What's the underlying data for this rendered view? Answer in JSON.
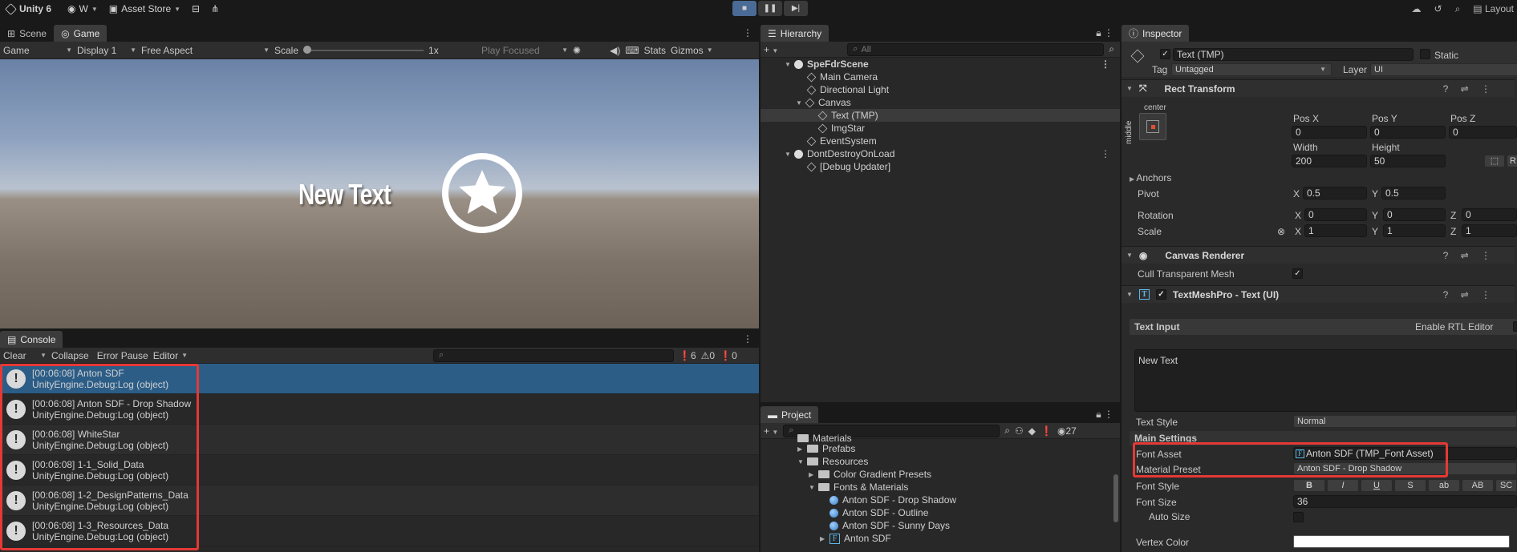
{
  "toolbar": {
    "app": "Unity 6",
    "account": "W",
    "asset_store": "Asset Store",
    "layout": "Layout"
  },
  "scene_game": {
    "tabs": [
      "Scene",
      "Game"
    ],
    "game_dropdown": "Game",
    "display": "Display 1",
    "aspect": "Free Aspect",
    "scale_label": "Scale",
    "scale_value": "1x",
    "play_focused": "Play Focused",
    "stats": "Stats",
    "gizmos": "Gizmos",
    "new_text": "New Text"
  },
  "console": {
    "tab": "Console",
    "clear": "Clear",
    "collapse": "Collapse",
    "error_pause": "Error Pause",
    "editor": "Editor",
    "count_log": "6",
    "count_warn": "0",
    "count_err": "0",
    "entries": [
      {
        "line1": "[00:06:08] Anton SDF",
        "line2": "UnityEngine.Debug:Log (object)"
      },
      {
        "line1": "[00:06:08] Anton SDF - Drop Shadow",
        "line2": "UnityEngine.Debug:Log (object)"
      },
      {
        "line1": "[00:06:08] WhiteStar",
        "line2": "UnityEngine.Debug:Log (object)"
      },
      {
        "line1": "[00:06:08] 1-1_Solid_Data",
        "line2": "UnityEngine.Debug:Log (object)"
      },
      {
        "line1": "[00:06:08] 1-2_DesignPatterns_Data",
        "line2": "UnityEngine.Debug:Log (object)"
      },
      {
        "line1": "[00:06:08] 1-3_Resources_Data",
        "line2": "UnityEngine.Debug:Log (object)"
      }
    ]
  },
  "hierarchy": {
    "tab": "Hierarchy",
    "search_placeholder": "All",
    "items": [
      "SpeFdrScene",
      "Main Camera",
      "Directional Light",
      "Canvas",
      "Text (TMP)",
      "ImgStar",
      "EventSystem",
      "DontDestroyOnLoad",
      "[Debug Updater]"
    ]
  },
  "project": {
    "tab": "Project",
    "hidden_count": "27",
    "items": [
      "Materials",
      "Prefabs",
      "Resources",
      "Color Gradient Presets",
      "Fonts & Materials",
      "Anton SDF - Drop Shadow",
      "Anton SDF - Outline",
      "Anton SDF - Sunny Days",
      "Anton SDF"
    ]
  },
  "inspector": {
    "tab": "Inspector",
    "object_name": "Text (TMP)",
    "static": "Static",
    "tag_label": "Tag",
    "tag": "Untagged",
    "layer_label": "Layer",
    "layer": "UI",
    "rect_transform": "Rect Transform",
    "anchor_h": "center",
    "anchor_v": "middle",
    "pos_x_label": "Pos X",
    "pos_y_label": "Pos Y",
    "pos_z_label": "Pos Z",
    "pos_x": "0",
    "pos_y": "0",
    "pos_z": "0",
    "width_label": "Width",
    "height_label": "Height",
    "width": "200",
    "height": "50",
    "anchors": "Anchors",
    "pivot": "Pivot",
    "pivot_x": "0.5",
    "pivot_y": "0.5",
    "rotation": "Rotation",
    "rot_x": "0",
    "rot_y": "0",
    "rot_z": "0",
    "scale": "Scale",
    "scale_x": "1",
    "scale_y": "1",
    "scale_z": "1",
    "canvas_renderer": "Canvas Renderer",
    "cull_transparent": "Cull Transparent Mesh",
    "tmp_component": "TextMeshPro - Text (UI)",
    "text_input": "Text Input",
    "enable_rtl": "Enable RTL Editor",
    "text_value": "New Text",
    "text_style_label": "Text Style",
    "text_style": "Normal",
    "main_settings": "Main Settings",
    "font_asset_label": "Font Asset",
    "font_asset": "Anton SDF (TMP_Font Asset)",
    "material_preset_label": "Material Preset",
    "material_preset": "Anton SDF - Drop Shadow",
    "font_style_label": "Font Style",
    "font_style_buttons": [
      "B",
      "I",
      "U",
      "S",
      "ab",
      "AB",
      "SC"
    ],
    "font_size_label": "Font Size",
    "font_size": "36",
    "auto_size": "Auto Size",
    "vertex_color": "Vertex Color"
  }
}
